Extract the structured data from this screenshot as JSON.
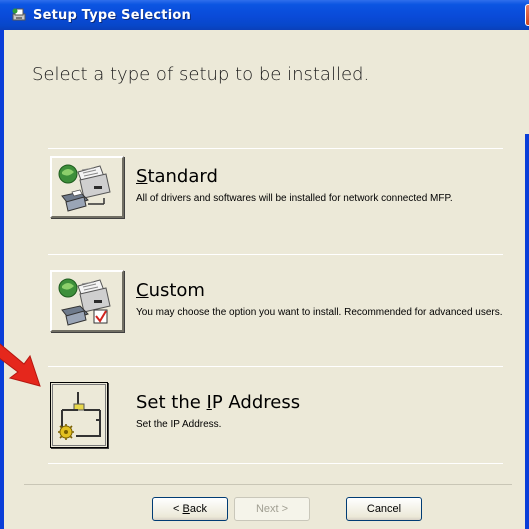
{
  "window": {
    "title": "Setup Type Selection",
    "close_label": "X"
  },
  "header": {
    "instruction": "Select a type of setup to be installed."
  },
  "options": [
    {
      "title_prefix": "",
      "title_underline": "S",
      "title_rest": "tandard",
      "description": "All of drivers and softwares will be installed for network connected MFP.",
      "icon": "printer-network-icon"
    },
    {
      "title_prefix": "",
      "title_underline": "C",
      "title_rest": "ustom",
      "description": "You may choose the option you want to install. Recommended for advanced users.",
      "icon": "printer-custom-icon"
    },
    {
      "title_prefix": "Set the ",
      "title_underline": "I",
      "title_rest": "P Address",
      "description": "Set the IP Address.",
      "icon": "network-gear-icon"
    }
  ],
  "footer": {
    "back_underline": "B",
    "back_rest": "ack",
    "back_prefix": "< ",
    "next_label": "Next >",
    "cancel_label": "Cancel"
  },
  "colors": {
    "titlebar": "#0a4ad8",
    "dialog_bg": "#ece9d8",
    "arrow": "#e5271c"
  }
}
